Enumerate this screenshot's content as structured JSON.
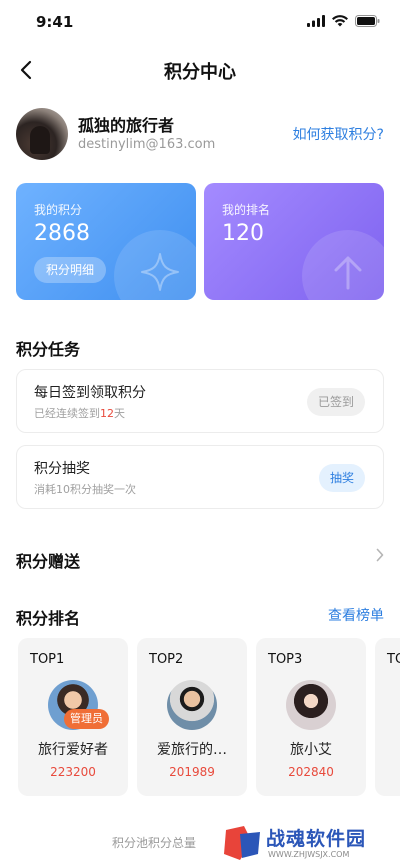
{
  "status_bar": {
    "time": "9:41",
    "icons": [
      "signal-icon",
      "wifi-icon",
      "battery-icon"
    ]
  },
  "nav": {
    "title": "积分中心",
    "back_icon": "chevron-left-icon"
  },
  "profile": {
    "name": "孤独的旅行者",
    "email": "destinylim@163.com",
    "how_link": "如何获取积分?"
  },
  "points_card": {
    "label": "我的积分",
    "value": "2868",
    "detail_button": "积分明细",
    "icon": "star-icon"
  },
  "rank_card": {
    "label": "我的排名",
    "value": "120",
    "icon": "arrow-up-icon"
  },
  "tasks": {
    "title": "积分任务",
    "items": [
      {
        "title": "每日签到领取积分",
        "sub_prefix": "已经连续签到",
        "sub_highlight": "12",
        "sub_suffix": "天",
        "button": "已签到",
        "state": "done"
      },
      {
        "title": "积分抽奖",
        "sub": "消耗10积分抽奖一次",
        "button": "抽奖",
        "state": "active"
      }
    ]
  },
  "gift": {
    "title": "积分赠送",
    "icon": "chevron-right-icon"
  },
  "ranking": {
    "title": "积分排名",
    "view_link": "查看榜单",
    "items": [
      {
        "rank": "TOP1",
        "name": "旅行爱好者",
        "score": "223200",
        "badge": "管理员"
      },
      {
        "rank": "TOP2",
        "name": "爱旅行的…",
        "score": "201989"
      },
      {
        "rank": "TOP3",
        "name": "旅小艾",
        "score": "202840"
      },
      {
        "rank": "TO"
      }
    ]
  },
  "footer": {
    "text": "积分池积分总量",
    "brand_name": "战魂软件园",
    "brand_url": "WWW.ZHJWSJX.COM"
  },
  "colors": {
    "accent_blue": "#2e7fe0",
    "highlight_red": "#e84a3c",
    "badge_orange": "#f06e36",
    "points_card": "#4a96f2",
    "rank_card": "#8a6ff3"
  }
}
